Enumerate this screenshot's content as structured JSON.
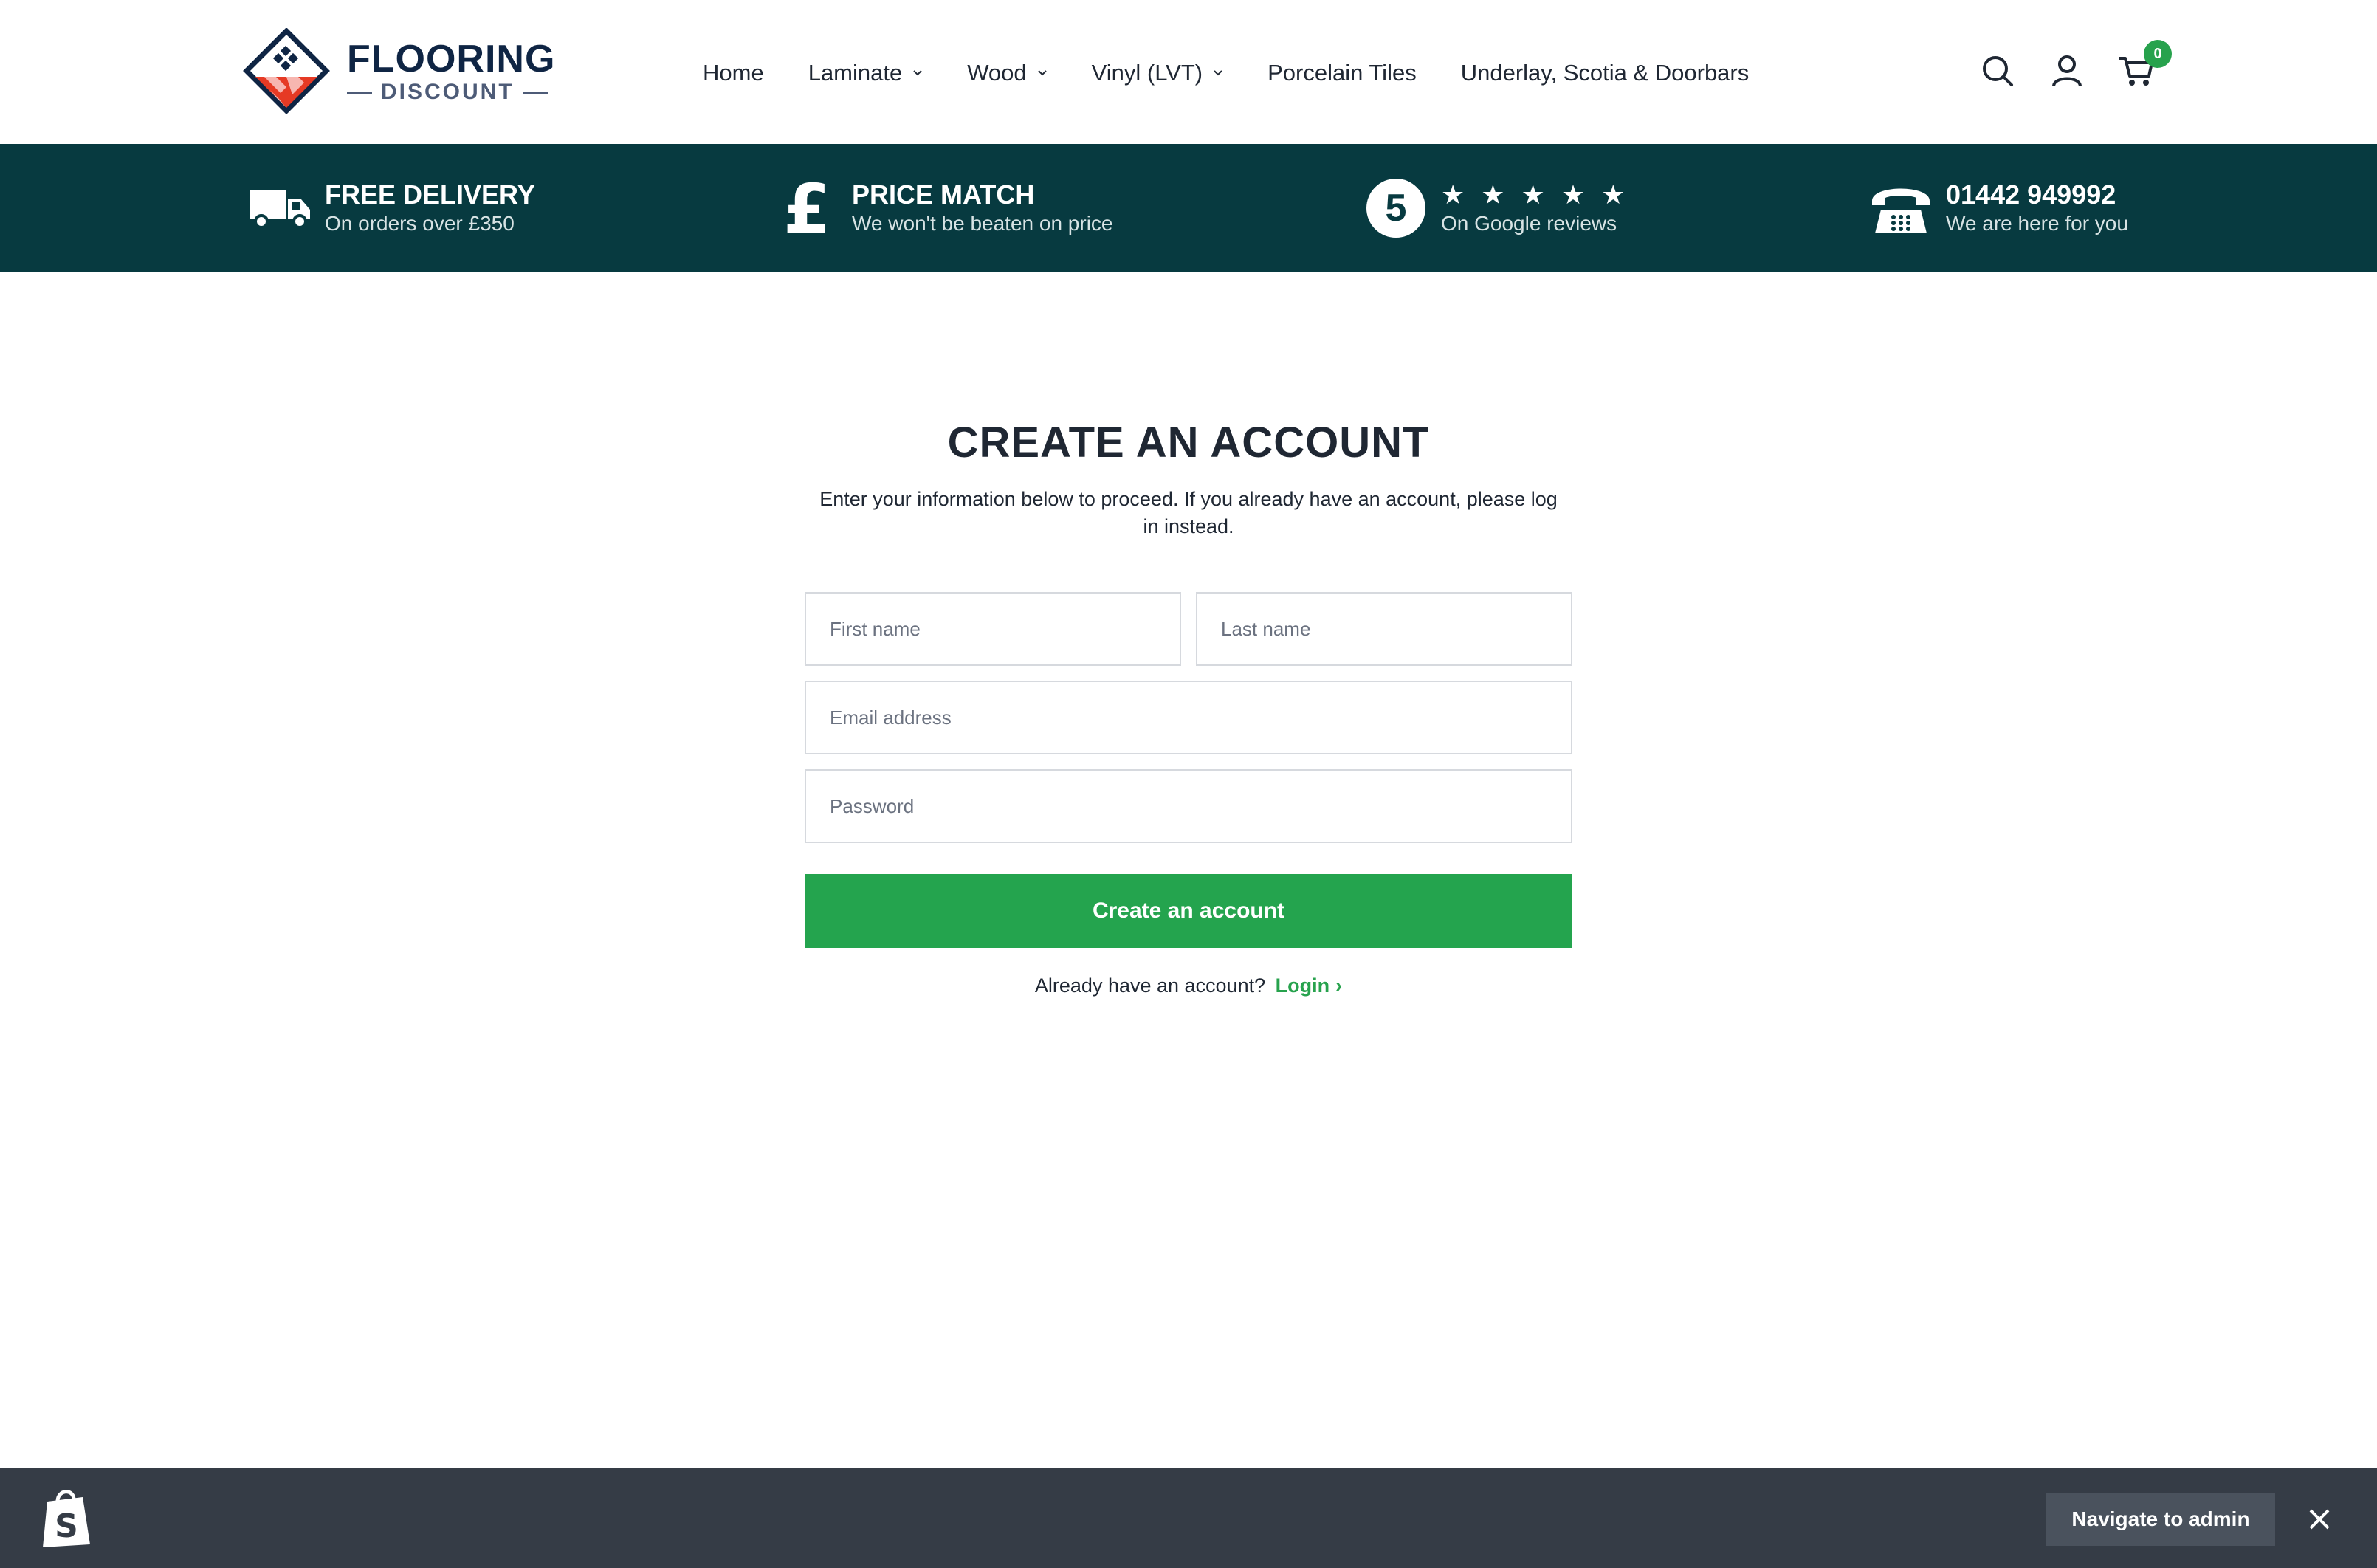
{
  "brand": {
    "name": "FLOORING",
    "sub": "DISCOUNT"
  },
  "nav": [
    {
      "label": "Home",
      "has_dropdown": false
    },
    {
      "label": "Laminate",
      "has_dropdown": true
    },
    {
      "label": "Wood",
      "has_dropdown": true
    },
    {
      "label": "Vinyl (LVT)",
      "has_dropdown": true
    },
    {
      "label": "Porcelain Tiles",
      "has_dropdown": false
    },
    {
      "label": "Underlay, Scotia & Doorbars",
      "has_dropdown": false
    }
  ],
  "header_icons": {
    "search": "search-icon",
    "account": "user-icon",
    "cart": "cart-icon",
    "cart_count": "0"
  },
  "usp": [
    {
      "icon": "truck-icon",
      "title": "FREE DELIVERY",
      "subtitle": "On orders over £350"
    },
    {
      "icon": "pound-icon",
      "title": "PRICE MATCH",
      "subtitle": "We won't be beaten on price"
    },
    {
      "icon": "five-badge-icon",
      "badge": "5",
      "stars": "★ ★ ★ ★ ★",
      "subtitle": "On Google reviews"
    },
    {
      "icon": "phone-icon",
      "title": "01442 949992",
      "subtitle": "We are here for you"
    }
  ],
  "form": {
    "title": "CREATE AN ACCOUNT",
    "intro": "Enter your information below to proceed. If you already have an account, please log in instead.",
    "first_name_placeholder": "First name",
    "last_name_placeholder": "Last name",
    "email_placeholder": "Email address",
    "password_placeholder": "Password",
    "submit_label": "Create an account",
    "login_prompt": "Already have an account?",
    "login_link": "Login",
    "login_chevron": "›"
  },
  "admin_bar": {
    "button_label": "Navigate to admin",
    "close": "close-icon"
  },
  "colors": {
    "usp_bg": "#073a40",
    "accent_green": "#24a44e",
    "admin_bg": "#353c46",
    "brand_navy": "#0f2544",
    "logo_red": "#e63a24"
  }
}
